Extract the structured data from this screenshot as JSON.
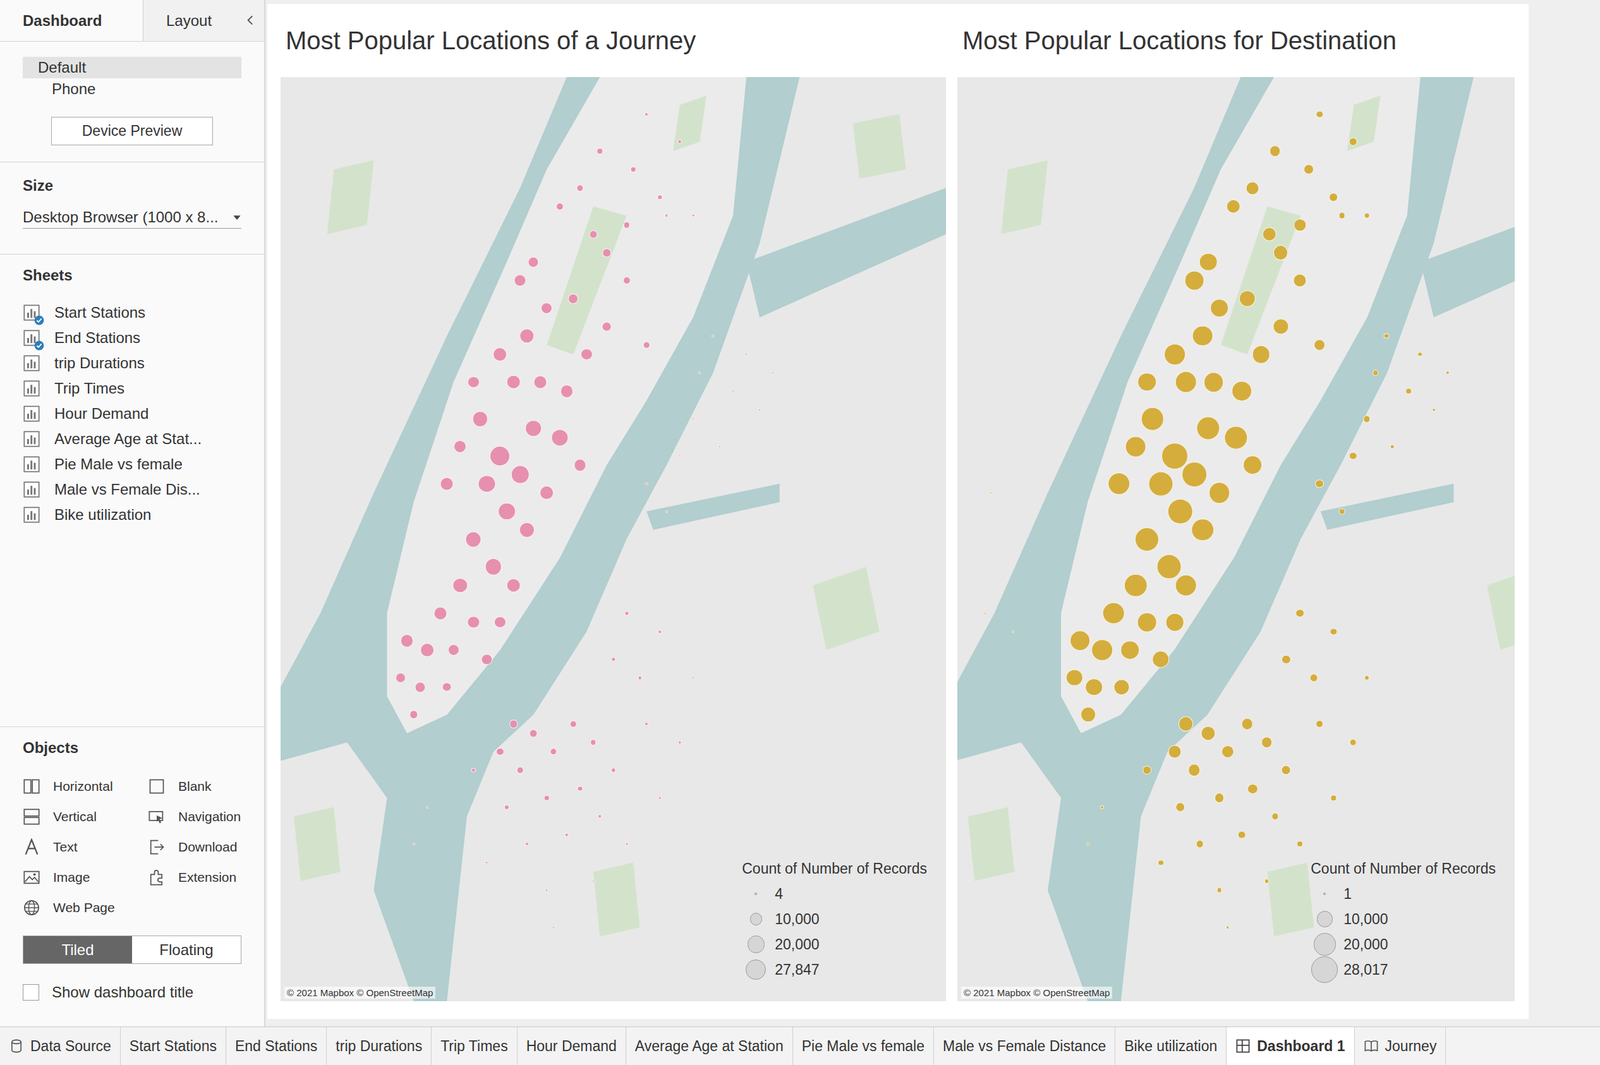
{
  "sidebar": {
    "tabs": [
      {
        "label": "Dashboard",
        "selected": true
      },
      {
        "label": "Layout",
        "selected": false
      }
    ],
    "devices": [
      {
        "label": "Default",
        "selected": true
      },
      {
        "label": "Phone",
        "selected": false
      }
    ],
    "device_preview_button": "Device Preview",
    "size": {
      "heading": "Size",
      "value": "Desktop Browser (1000 x 8..."
    },
    "sheets": {
      "heading": "Sheets",
      "items": [
        {
          "label": "Start Stations",
          "in_use": true
        },
        {
          "label": "End Stations",
          "in_use": true
        },
        {
          "label": "trip Durations",
          "in_use": false
        },
        {
          "label": "Trip Times",
          "in_use": false
        },
        {
          "label": "Hour Demand",
          "in_use": false
        },
        {
          "label": "Average Age at Stat...",
          "in_use": false
        },
        {
          "label": "Pie Male vs female",
          "in_use": false
        },
        {
          "label": "Male vs Female Dis...",
          "in_use": false
        },
        {
          "label": "Bike utilization",
          "in_use": false
        }
      ]
    },
    "objects": {
      "heading": "Objects",
      "items": [
        "Horizontal",
        "Blank",
        "Vertical",
        "Navigation",
        "Text",
        "Download",
        "Image",
        "Extension",
        "Web Page"
      ]
    },
    "layout_mode": [
      {
        "label": "Tiled",
        "selected": true
      },
      {
        "label": "Floating",
        "selected": false
      }
    ],
    "show_title": {
      "label": "Show dashboard title",
      "checked": false
    }
  },
  "maps": [
    {
      "title": "Most Popular Locations of a Journey",
      "color": "#e78fae",
      "attribution": "© 2021 Mapbox © OpenStreetMap",
      "legend": {
        "title": "Count of Number of Records",
        "items": [
          {
            "label": "4",
            "value": 4
          },
          {
            "label": "10,000",
            "value": 10000
          },
          {
            "label": "20,000",
            "value": 20000
          },
          {
            "label": "27,847",
            "value": 27847
          }
        ]
      },
      "bubbles": [
        [
          0.33,
          0.41,
          27847
        ],
        [
          0.36,
          0.43,
          22000
        ],
        [
          0.31,
          0.44,
          20000
        ],
        [
          0.38,
          0.38,
          18000
        ],
        [
          0.34,
          0.47,
          21000
        ],
        [
          0.29,
          0.5,
          17000
        ],
        [
          0.37,
          0.49,
          16000
        ],
        [
          0.32,
          0.53,
          19000
        ],
        [
          0.27,
          0.55,
          15000
        ],
        [
          0.35,
          0.55,
          14000
        ],
        [
          0.4,
          0.45,
          13000
        ],
        [
          0.42,
          0.39,
          20000
        ],
        [
          0.25,
          0.44,
          12000
        ],
        [
          0.27,
          0.4,
          11000
        ],
        [
          0.3,
          0.37,
          16000
        ],
        [
          0.35,
          0.33,
          14000
        ],
        [
          0.39,
          0.33,
          12000
        ],
        [
          0.33,
          0.3,
          13000
        ],
        [
          0.37,
          0.28,
          15000
        ],
        [
          0.29,
          0.33,
          9000
        ],
        [
          0.24,
          0.58,
          12000
        ],
        [
          0.22,
          0.62,
          13000
        ],
        [
          0.19,
          0.61,
          11000
        ],
        [
          0.26,
          0.62,
          9000
        ],
        [
          0.21,
          0.66,
          8000
        ],
        [
          0.18,
          0.65,
          7000
        ],
        [
          0.2,
          0.69,
          5000
        ],
        [
          0.29,
          0.59,
          10000
        ],
        [
          0.31,
          0.63,
          8000
        ],
        [
          0.25,
          0.66,
          6000
        ],
        [
          0.33,
          0.59,
          9000
        ],
        [
          0.4,
          0.25,
          9000
        ],
        [
          0.36,
          0.22,
          10000
        ],
        [
          0.38,
          0.2,
          8000
        ],
        [
          0.44,
          0.24,
          7000
        ],
        [
          0.46,
          0.3,
          9000
        ],
        [
          0.49,
          0.27,
          6000
        ],
        [
          0.43,
          0.34,
          11000
        ],
        [
          0.45,
          0.42,
          10000
        ],
        [
          0.49,
          0.19,
          5000
        ],
        [
          0.52,
          0.22,
          4000
        ],
        [
          0.55,
          0.29,
          3000
        ],
        [
          0.42,
          0.14,
          4000
        ],
        [
          0.45,
          0.12,
          3500
        ],
        [
          0.48,
          0.08,
          2500
        ],
        [
          0.53,
          0.1,
          2000
        ],
        [
          0.57,
          0.13,
          1500
        ],
        [
          0.6,
          0.07,
          1200
        ],
        [
          0.55,
          0.04,
          1000
        ],
        [
          0.58,
          0.15,
          900
        ],
        [
          0.62,
          0.15,
          600
        ],
        [
          0.52,
          0.16,
          3000
        ],
        [
          0.47,
          0.17,
          4500
        ],
        [
          0.65,
          0.28,
          200
        ],
        [
          0.7,
          0.3,
          150
        ],
        [
          0.74,
          0.32,
          100
        ],
        [
          0.68,
          0.34,
          300
        ],
        [
          0.62,
          0.37,
          400
        ],
        [
          0.6,
          0.41,
          500
        ],
        [
          0.55,
          0.44,
          600
        ],
        [
          0.58,
          0.47,
          300
        ],
        [
          0.66,
          0.4,
          100
        ],
        [
          0.72,
          0.36,
          80
        ],
        [
          0.63,
          0.32,
          250
        ],
        [
          0.35,
          0.7,
          5000
        ],
        [
          0.38,
          0.71,
          4500
        ],
        [
          0.33,
          0.73,
          4000
        ],
        [
          0.41,
          0.73,
          3500
        ],
        [
          0.36,
          0.75,
          3000
        ],
        [
          0.44,
          0.7,
          3000
        ],
        [
          0.47,
          0.72,
          2500
        ],
        [
          0.4,
          0.78,
          2000
        ],
        [
          0.34,
          0.79,
          1800
        ],
        [
          0.45,
          0.77,
          2200
        ],
        [
          0.5,
          0.75,
          1500
        ],
        [
          0.29,
          0.75,
          1200
        ],
        [
          0.37,
          0.83,
          1000
        ],
        [
          0.43,
          0.82,
          1100
        ],
        [
          0.48,
          0.8,
          900
        ],
        [
          0.52,
          0.83,
          700
        ],
        [
          0.31,
          0.85,
          600
        ],
        [
          0.4,
          0.88,
          500
        ],
        [
          0.47,
          0.87,
          400
        ],
        [
          0.57,
          0.78,
          600
        ],
        [
          0.6,
          0.72,
          800
        ],
        [
          0.55,
          0.7,
          1000
        ],
        [
          0.54,
          0.65,
          1200
        ],
        [
          0.5,
          0.63,
          1500
        ],
        [
          0.52,
          0.58,
          1400
        ],
        [
          0.57,
          0.6,
          900
        ],
        [
          0.62,
          0.65,
          500
        ],
        [
          0.2,
          0.83,
          200
        ],
        [
          0.22,
          0.79,
          300
        ],
        [
          0.41,
          0.92,
          300
        ]
      ]
    },
    {
      "title": "Most Popular Locations for Destination",
      "color": "#d4ad3c",
      "attribution": "© 2021 Mapbox © OpenStreetMap",
      "legend": {
        "title": "Count of Number of Records",
        "items": [
          {
            "label": "1",
            "value": 1
          },
          {
            "label": "10,000",
            "value": 10000
          },
          {
            "label": "20,000",
            "value": 20000
          },
          {
            "label": "28,017",
            "value": 28017
          }
        ]
      },
      "bubbles": [
        [
          0.39,
          0.41,
          28017
        ],
        [
          0.425,
          0.43,
          25000
        ],
        [
          0.365,
          0.44,
          24000
        ],
        [
          0.45,
          0.38,
          22000
        ],
        [
          0.4,
          0.47,
          26000
        ],
        [
          0.34,
          0.5,
          23000
        ],
        [
          0.44,
          0.49,
          20000
        ],
        [
          0.38,
          0.53,
          24000
        ],
        [
          0.32,
          0.55,
          21000
        ],
        [
          0.41,
          0.55,
          19000
        ],
        [
          0.47,
          0.45,
          18000
        ],
        [
          0.5,
          0.39,
          22000
        ],
        [
          0.29,
          0.44,
          20000
        ],
        [
          0.32,
          0.4,
          17000
        ],
        [
          0.35,
          0.37,
          21000
        ],
        [
          0.41,
          0.33,
          19000
        ],
        [
          0.46,
          0.33,
          16000
        ],
        [
          0.39,
          0.3,
          18000
        ],
        [
          0.44,
          0.28,
          17000
        ],
        [
          0.34,
          0.33,
          14000
        ],
        [
          0.28,
          0.58,
          19000
        ],
        [
          0.26,
          0.62,
          18000
        ],
        [
          0.22,
          0.61,
          16000
        ],
        [
          0.31,
          0.62,
          14000
        ],
        [
          0.245,
          0.66,
          12000
        ],
        [
          0.21,
          0.65,
          11000
        ],
        [
          0.235,
          0.69,
          9000
        ],
        [
          0.34,
          0.59,
          15000
        ],
        [
          0.365,
          0.63,
          12000
        ],
        [
          0.295,
          0.66,
          10000
        ],
        [
          0.39,
          0.59,
          13000
        ],
        [
          0.47,
          0.25,
          14000
        ],
        [
          0.425,
          0.22,
          15000
        ],
        [
          0.45,
          0.2,
          13000
        ],
        [
          0.52,
          0.24,
          11000
        ],
        [
          0.545,
          0.3,
          13000
        ],
        [
          0.58,
          0.27,
          10000
        ],
        [
          0.51,
          0.34,
          16000
        ],
        [
          0.53,
          0.42,
          14000
        ],
        [
          0.58,
          0.19,
          9000
        ],
        [
          0.615,
          0.22,
          7000
        ],
        [
          0.65,
          0.29,
          5000
        ],
        [
          0.495,
          0.14,
          8000
        ],
        [
          0.53,
          0.12,
          7000
        ],
        [
          0.57,
          0.08,
          5000
        ],
        [
          0.63,
          0.1,
          4000
        ],
        [
          0.675,
          0.13,
          3000
        ],
        [
          0.71,
          0.07,
          2500
        ],
        [
          0.65,
          0.04,
          2000
        ],
        [
          0.69,
          0.15,
          1800
        ],
        [
          0.735,
          0.15,
          1200
        ],
        [
          0.615,
          0.16,
          6000
        ],
        [
          0.56,
          0.17,
          8000
        ],
        [
          0.77,
          0.28,
          1200
        ],
        [
          0.83,
          0.3,
          900
        ],
        [
          0.88,
          0.32,
          600
        ],
        [
          0.81,
          0.34,
          1500
        ],
        [
          0.735,
          0.37,
          2000
        ],
        [
          0.71,
          0.41,
          2500
        ],
        [
          0.65,
          0.44,
          3000
        ],
        [
          0.69,
          0.47,
          1800
        ],
        [
          0.78,
          0.4,
          700
        ],
        [
          0.855,
          0.36,
          500
        ],
        [
          0.75,
          0.32,
          1400
        ],
        [
          0.41,
          0.7,
          9000
        ],
        [
          0.45,
          0.71,
          8500
        ],
        [
          0.39,
          0.73,
          7000
        ],
        [
          0.485,
          0.73,
          6500
        ],
        [
          0.425,
          0.75,
          6000
        ],
        [
          0.52,
          0.7,
          5500
        ],
        [
          0.555,
          0.72,
          5000
        ],
        [
          0.47,
          0.78,
          4000
        ],
        [
          0.4,
          0.79,
          3800
        ],
        [
          0.53,
          0.77,
          4200
        ],
        [
          0.59,
          0.75,
          3500
        ],
        [
          0.34,
          0.75,
          3000
        ],
        [
          0.435,
          0.83,
          2500
        ],
        [
          0.51,
          0.82,
          2600
        ],
        [
          0.57,
          0.8,
          2000
        ],
        [
          0.615,
          0.83,
          1600
        ],
        [
          0.365,
          0.85,
          1500
        ],
        [
          0.47,
          0.88,
          1200
        ],
        [
          0.555,
          0.87,
          1000
        ],
        [
          0.675,
          0.78,
          1400
        ],
        [
          0.71,
          0.72,
          1800
        ],
        [
          0.65,
          0.7,
          2200
        ],
        [
          0.64,
          0.65,
          2600
        ],
        [
          0.59,
          0.63,
          3200
        ],
        [
          0.615,
          0.58,
          3000
        ],
        [
          0.675,
          0.6,
          2000
        ],
        [
          0.735,
          0.65,
          1000
        ],
        [
          0.235,
          0.83,
          400
        ],
        [
          0.26,
          0.79,
          600
        ],
        [
          0.485,
          0.92,
          500
        ],
        [
          0.06,
          0.45,
          10
        ],
        [
          0.05,
          0.58,
          20
        ],
        [
          0.1,
          0.6,
          15
        ]
      ]
    }
  ],
  "bottom_tabs": [
    {
      "label": "Data Source",
      "selected": false,
      "kind": "datasource"
    },
    {
      "label": "Start Stations",
      "selected": false,
      "kind": "sheet"
    },
    {
      "label": "End Stations",
      "selected": false,
      "kind": "sheet"
    },
    {
      "label": "trip Durations",
      "selected": false,
      "kind": "sheet"
    },
    {
      "label": "Trip Times",
      "selected": false,
      "kind": "sheet"
    },
    {
      "label": "Hour Demand",
      "selected": false,
      "kind": "sheet"
    },
    {
      "label": "Average Age at Station",
      "selected": false,
      "kind": "sheet"
    },
    {
      "label": "Pie Male vs female",
      "selected": false,
      "kind": "sheet"
    },
    {
      "label": "Male vs Female Distance",
      "selected": false,
      "kind": "sheet"
    },
    {
      "label": "Bike utilization",
      "selected": false,
      "kind": "sheet"
    },
    {
      "label": "Dashboard 1",
      "selected": true,
      "kind": "dashboard"
    },
    {
      "label": "Journey",
      "selected": false,
      "kind": "story"
    }
  ]
}
